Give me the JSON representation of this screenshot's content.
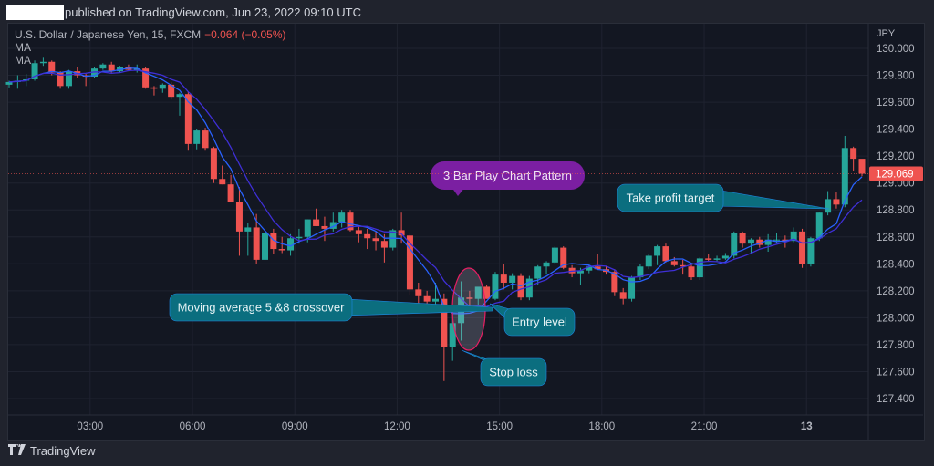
{
  "header": {
    "published_text": "published on TradingView.com, Jun 23, 2022 09:10 UTC"
  },
  "legend": {
    "symbol": "U.S. Dollar / Japanese Yen, 15, FXCM",
    "change": "−0.064 (−0.05%)",
    "indicators": [
      "MA",
      "MA"
    ]
  },
  "footer": {
    "logo_icon": "tradingview-logo-icon",
    "brand": "TradingView"
  },
  "colors": {
    "up": "#26a69a",
    "down": "#ef5350",
    "ma_fast": "#2962ff",
    "ma_slow": "#3f2fd6",
    "annotation_teal": "#0b6e7f",
    "annotation_purple": "#7b1fa2",
    "last_price_badge": "#ef5350",
    "ellipse_stroke": "#e91e63"
  },
  "chart_data": {
    "type": "candlestick",
    "title": "U.S. Dollar / Japanese Yen, 15, FXCM",
    "currency_label": "JPY",
    "ylim": [
      127.25,
      130.15
    ],
    "y_ticks": [
      "130.000",
      "129.800",
      "129.600",
      "129.400",
      "129.200",
      "129.000",
      "128.800",
      "128.600",
      "128.400",
      "128.200",
      "128.000",
      "127.800",
      "127.600",
      "127.400"
    ],
    "x_ticks": [
      {
        "label": "03:00",
        "index": 9.5,
        "bold": false
      },
      {
        "label": "06:00",
        "index": 21.5,
        "bold": false
      },
      {
        "label": "09:00",
        "index": 33.5,
        "bold": false
      },
      {
        "label": "12:00",
        "index": 45.5,
        "bold": false
      },
      {
        "label": "15:00",
        "index": 57.5,
        "bold": false
      },
      {
        "label": "18:00",
        "index": 69.5,
        "bold": false
      },
      {
        "label": "21:00",
        "index": 81.5,
        "bold": false
      },
      {
        "label": "13",
        "index": 93.5,
        "bold": true
      }
    ],
    "last_price": "129.069",
    "last_price_value": 129.069,
    "candles": [
      [
        129.73,
        129.76,
        129.71,
        129.75
      ],
      [
        129.75,
        129.8,
        129.7,
        129.76
      ],
      [
        129.76,
        129.81,
        129.72,
        129.77
      ],
      [
        129.77,
        129.91,
        129.76,
        129.89
      ],
      [
        129.89,
        129.93,
        129.87,
        129.9
      ],
      [
        129.9,
        129.91,
        129.8,
        129.82
      ],
      [
        129.82,
        129.83,
        129.7,
        129.72
      ],
      [
        129.72,
        129.84,
        129.7,
        129.83
      ],
      [
        129.83,
        129.86,
        129.78,
        129.8
      ],
      [
        129.8,
        129.81,
        129.72,
        129.79
      ],
      [
        129.79,
        129.86,
        129.78,
        129.85
      ],
      [
        129.85,
        129.89,
        129.84,
        129.88
      ],
      [
        129.88,
        129.9,
        129.82,
        129.83
      ],
      [
        129.83,
        129.87,
        129.82,
        129.86
      ],
      [
        129.86,
        129.88,
        129.83,
        129.84
      ],
      [
        129.84,
        129.88,
        129.82,
        129.85
      ],
      [
        129.85,
        129.86,
        129.7,
        129.71
      ],
      [
        129.71,
        129.72,
        129.65,
        129.7
      ],
      [
        129.7,
        129.74,
        129.67,
        129.73
      ],
      [
        129.73,
        129.75,
        129.62,
        129.64
      ],
      [
        129.64,
        129.67,
        129.5,
        129.66
      ],
      [
        129.66,
        129.68,
        129.24,
        129.29
      ],
      [
        129.29,
        129.4,
        129.25,
        129.39
      ],
      [
        129.39,
        129.41,
        129.24,
        129.26
      ],
      [
        129.26,
        129.27,
        129.0,
        129.03
      ],
      [
        129.03,
        129.13,
        128.99,
        128.99
      ],
      [
        128.99,
        129.06,
        128.87,
        128.86
      ],
      [
        128.86,
        128.97,
        128.46,
        128.64
      ],
      [
        128.64,
        128.7,
        128.46,
        128.67
      ],
      [
        128.67,
        128.77,
        128.4,
        128.43
      ],
      [
        128.43,
        128.67,
        128.43,
        128.63
      ],
      [
        128.63,
        128.66,
        128.47,
        128.51
      ],
      [
        128.51,
        128.6,
        128.48,
        128.5
      ],
      [
        128.5,
        128.62,
        128.46,
        128.59
      ],
      [
        128.59,
        128.66,
        128.55,
        128.6
      ],
      [
        128.6,
        128.73,
        128.56,
        128.73
      ],
      [
        128.73,
        128.81,
        128.68,
        128.68
      ],
      [
        128.68,
        128.75,
        128.57,
        128.66
      ],
      [
        128.66,
        128.78,
        128.64,
        128.71
      ],
      [
        128.71,
        128.8,
        128.67,
        128.78
      ],
      [
        128.78,
        128.8,
        128.64,
        128.65
      ],
      [
        128.65,
        128.68,
        128.56,
        128.62
      ],
      [
        128.62,
        128.66,
        128.51,
        128.59
      ],
      [
        128.59,
        128.64,
        128.5,
        128.57
      ],
      [
        128.57,
        128.62,
        128.41,
        128.52
      ],
      [
        128.52,
        128.66,
        128.5,
        128.65
      ],
      [
        128.65,
        128.78,
        128.55,
        128.61
      ],
      [
        128.61,
        128.63,
        128.17,
        128.21
      ],
      [
        128.21,
        128.26,
        128.05,
        128.16
      ],
      [
        128.16,
        128.2,
        128.07,
        128.12
      ],
      [
        128.12,
        128.26,
        128.09,
        128.14
      ],
      [
        128.14,
        128.18,
        127.53,
        127.78
      ],
      [
        127.78,
        128.04,
        127.68,
        127.96
      ],
      [
        127.96,
        128.27,
        127.83,
        128.15
      ],
      [
        128.15,
        128.2,
        128.06,
        128.14
      ],
      [
        128.14,
        128.21,
        128.09,
        128.23
      ],
      [
        128.23,
        128.24,
        128.14,
        128.14
      ],
      [
        128.14,
        128.34,
        128.13,
        128.32
      ],
      [
        128.32,
        128.4,
        128.21,
        128.26
      ],
      [
        128.26,
        128.33,
        128.21,
        128.31
      ],
      [
        128.31,
        128.33,
        128.13,
        128.15
      ],
      [
        128.15,
        128.31,
        128.13,
        128.29
      ],
      [
        128.29,
        128.39,
        128.24,
        128.38
      ],
      [
        128.38,
        128.42,
        128.32,
        128.41
      ],
      [
        128.41,
        128.53,
        128.4,
        128.52
      ],
      [
        128.52,
        128.53,
        128.36,
        128.37
      ],
      [
        128.37,
        128.39,
        128.3,
        128.33
      ],
      [
        128.33,
        128.37,
        128.24,
        128.35
      ],
      [
        128.35,
        128.39,
        128.33,
        128.38
      ],
      [
        128.38,
        128.47,
        128.37,
        128.36
      ],
      [
        128.36,
        128.38,
        128.32,
        128.34
      ],
      [
        128.34,
        128.36,
        128.16,
        128.19
      ],
      [
        128.19,
        128.22,
        128.1,
        128.14
      ],
      [
        128.14,
        128.31,
        128.12,
        128.3
      ],
      [
        128.3,
        128.4,
        128.28,
        128.38
      ],
      [
        128.38,
        128.47,
        128.36,
        128.46
      ],
      [
        128.46,
        128.54,
        128.39,
        128.53
      ],
      [
        128.53,
        128.55,
        128.41,
        128.42
      ],
      [
        128.42,
        128.45,
        128.38,
        128.39
      ],
      [
        128.39,
        128.43,
        128.32,
        128.38
      ],
      [
        128.38,
        128.4,
        128.28,
        128.3
      ],
      [
        128.3,
        128.45,
        128.28,
        128.44
      ],
      [
        128.44,
        128.47,
        128.42,
        128.43
      ],
      [
        128.43,
        128.46,
        128.42,
        128.44
      ],
      [
        128.44,
        128.48,
        128.43,
        128.46
      ],
      [
        128.46,
        128.64,
        128.44,
        128.63
      ],
      [
        128.63,
        128.64,
        128.52,
        128.55
      ],
      [
        128.55,
        128.59,
        128.47,
        128.58
      ],
      [
        128.58,
        128.6,
        128.52,
        128.54
      ],
      [
        128.54,
        128.62,
        128.49,
        128.58
      ],
      [
        128.58,
        128.63,
        128.55,
        128.58
      ],
      [
        128.58,
        128.61,
        128.52,
        128.57
      ],
      [
        128.57,
        128.67,
        128.56,
        128.64
      ],
      [
        128.64,
        128.66,
        128.37,
        128.4
      ],
      [
        128.4,
        128.6,
        128.38,
        128.59
      ],
      [
        128.59,
        128.78,
        128.57,
        128.78
      ],
      [
        128.78,
        128.94,
        128.76,
        128.88
      ],
      [
        128.88,
        128.93,
        128.81,
        128.84
      ],
      [
        128.84,
        129.35,
        128.82,
        129.26
      ],
      [
        129.26,
        129.27,
        129.09,
        129.18
      ],
      [
        129.18,
        129.14,
        129.05,
        129.069
      ]
    ],
    "moving_averages": [
      {
        "name": "MA",
        "period": 5
      },
      {
        "name": "MA",
        "period": 8
      }
    ],
    "annotations": [
      {
        "text": "3 Bar Play Chart Pattern",
        "style": "purple-callout"
      },
      {
        "text": "Moving average 5 &8 crossover",
        "style": "teal-callout"
      },
      {
        "text": "Entry level",
        "style": "teal-callout"
      },
      {
        "text": "Stop loss",
        "style": "teal-callout"
      },
      {
        "text": "Take profit target",
        "style": "teal-callout"
      }
    ]
  }
}
